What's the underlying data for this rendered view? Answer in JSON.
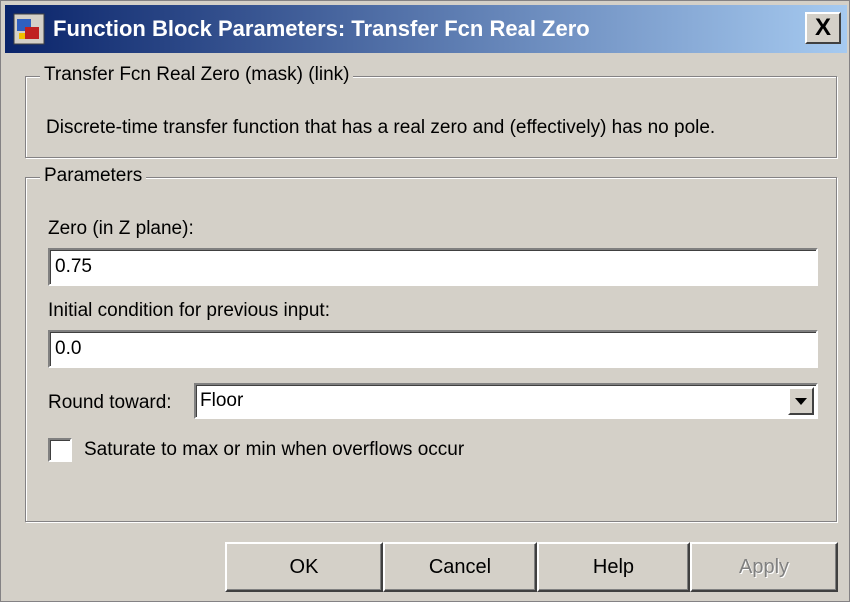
{
  "window": {
    "title": "Function Block Parameters: Transfer Fcn Real Zero",
    "close_label": "X"
  },
  "description_group": {
    "legend": "Transfer Fcn Real Zero (mask) (link)",
    "text": "Discrete-time transfer function that has a real zero and (effectively) has no pole."
  },
  "parameters_group": {
    "legend": "Parameters",
    "zero_label": "Zero (in Z plane):",
    "zero_value": "0.75",
    "ic_label": "Initial condition for previous input:",
    "ic_value": "0.0",
    "round_label": "Round toward:",
    "round_value": "Floor",
    "saturate_label": "Saturate to max or min when overflows occur",
    "saturate_checked": false
  },
  "buttons": {
    "ok": "OK",
    "cancel": "Cancel",
    "help": "Help",
    "apply": "Apply"
  },
  "icons": {
    "app": "simulink-block-icon",
    "dropdown": "chevron-down-icon",
    "close": "close-icon"
  }
}
